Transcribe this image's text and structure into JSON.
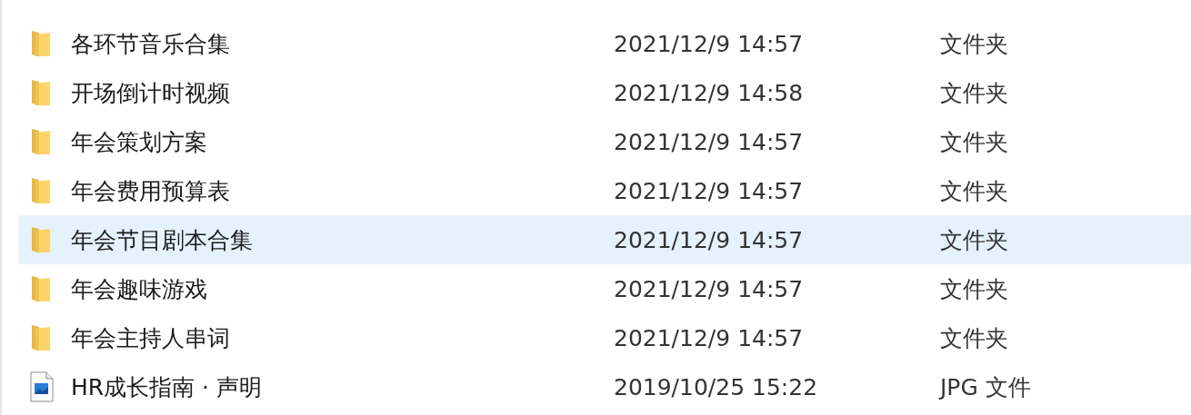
{
  "files": [
    {
      "kind": "folder",
      "name": "各环节音乐合集",
      "modified": "2021/12/9 14:57",
      "type": "文件夹",
      "selected": false
    },
    {
      "kind": "folder",
      "name": "开场倒计时视频",
      "modified": "2021/12/9 14:58",
      "type": "文件夹",
      "selected": false
    },
    {
      "kind": "folder",
      "name": "年会策划方案",
      "modified": "2021/12/9 14:57",
      "type": "文件夹",
      "selected": false
    },
    {
      "kind": "folder",
      "name": "年会费用预算表",
      "modified": "2021/12/9 14:57",
      "type": "文件夹",
      "selected": false
    },
    {
      "kind": "folder",
      "name": "年会节目剧本合集",
      "modified": "2021/12/9 14:57",
      "type": "文件夹",
      "selected": true
    },
    {
      "kind": "folder",
      "name": "年会趣味游戏",
      "modified": "2021/12/9 14:57",
      "type": "文件夹",
      "selected": false
    },
    {
      "kind": "folder",
      "name": "年会主持人串词",
      "modified": "2021/12/9 14:57",
      "type": "文件夹",
      "selected": false
    },
    {
      "kind": "image",
      "name": "HR成长指南 · 声明",
      "modified": "2019/10/25 15:22",
      "type": "JPG 文件",
      "selected": false
    }
  ]
}
